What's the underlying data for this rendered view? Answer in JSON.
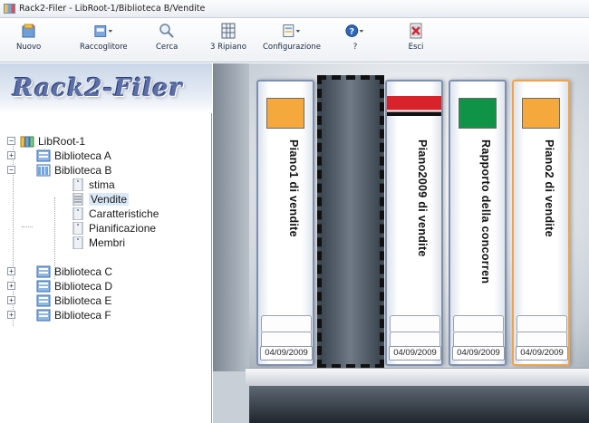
{
  "window": {
    "title": "Rack2-Filer - LibRoot-1/Biblioteca B/Vendite"
  },
  "toolbar": {
    "new_label": "Nuovo",
    "binder_label": "Raccoglitore",
    "search_label": "Cerca",
    "shelf_label": "3 Ripiano",
    "config_label": "Configurazione",
    "help_label": "?",
    "exit_label": "Esci"
  },
  "logo": {
    "text": "Rack2-Filer"
  },
  "tree": {
    "root": "LibRoot-1",
    "items": [
      {
        "label": "Biblioteca A"
      },
      {
        "label": "Biblioteca B"
      },
      {
        "label": "stima"
      },
      {
        "label": "Vendite"
      },
      {
        "label": "Caratteristiche"
      },
      {
        "label": "Pianificazione"
      },
      {
        "label": "Membri"
      },
      {
        "label": "Biblioteca C"
      },
      {
        "label": "Biblioteca D"
      },
      {
        "label": "Biblioteca E"
      },
      {
        "label": "Biblioteca F"
      }
    ]
  },
  "binders": [
    {
      "title": "Piano1 di vendite",
      "date": "04/09/2009",
      "color": "#f5a93d"
    },
    {
      "title": "Piano2009 di vendite",
      "date": "04/09/2009",
      "color": "#d8232a"
    },
    {
      "title": "Rapporto della concorren",
      "date": "04/09/2009",
      "color": "#0f9447"
    },
    {
      "title": "Piano2 di vendite",
      "date": "04/09/2009",
      "color": "#f5a93d"
    }
  ],
  "colors": {
    "accent_selected_border": "#f0a34a",
    "binder_border": "#7f8fb0"
  }
}
